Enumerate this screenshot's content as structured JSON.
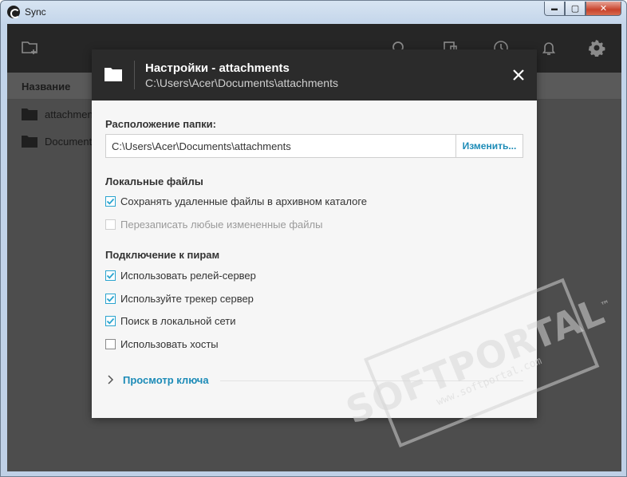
{
  "window": {
    "title": "Sync",
    "minimize_glyph": "▬",
    "maximize_glyph": "▢",
    "close_glyph": "✕"
  },
  "toolbar": {
    "icons": [
      "add-folder-icon",
      "search-icon",
      "device-icon",
      "history-icon",
      "bell-icon",
      "gear-icon"
    ]
  },
  "list": {
    "header": "Название",
    "folders": [
      {
        "name": "attachments"
      },
      {
        "name": "Documents"
      }
    ]
  },
  "modal": {
    "title": "Настройки - attachments",
    "subtitle": "C:\\Users\\Acer\\Documents\\attachments",
    "folder_location_label": "Расположение папки:",
    "folder_path": "C:\\Users\\Acer\\Documents\\attachments",
    "change_button": "Изменить...",
    "local_files_label": "Локальные файлы",
    "local_files": [
      {
        "label": "Сохранять удаленные файлы в архивном каталоге",
        "checked": true,
        "disabled": false
      },
      {
        "label": "Перезаписать любые измененные файлы",
        "checked": false,
        "disabled": true
      }
    ],
    "peer_label": "Подключение к пирам",
    "peer_options": [
      {
        "label": "Использовать релей-сервер",
        "checked": true
      },
      {
        "label": "Используйте трекер сервер",
        "checked": true
      },
      {
        "label": "Поиск в локальной сети",
        "checked": true
      },
      {
        "label": "Использовать хосты",
        "checked": false
      }
    ],
    "key_link": "Просмотр ключа"
  },
  "watermark": {
    "main": "SOFTPORTAL",
    "tm": "™",
    "sub": "www.softportal.com"
  },
  "colors": {
    "accent": "#1c8bb7",
    "checkbox": "#2aa4cf",
    "toolbar_bg": "#262626",
    "modal_header_bg": "#2b2b2b"
  }
}
